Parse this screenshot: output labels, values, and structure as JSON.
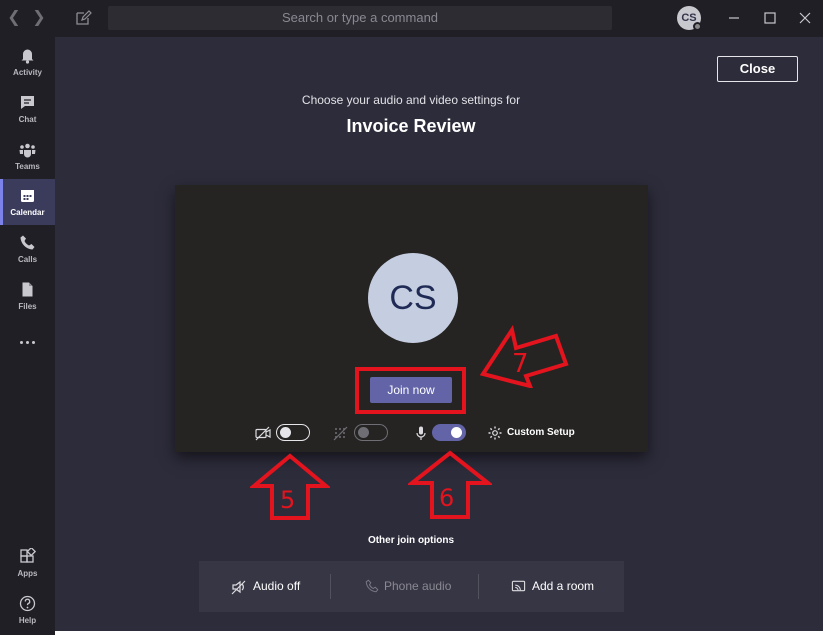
{
  "titlebar": {
    "back_icon": "chevron-left-icon",
    "forward_icon": "chevron-right-icon",
    "search_placeholder": "Search or type a command",
    "avatar_initials": "CS"
  },
  "sidebar": {
    "items": [
      {
        "label": "Activity",
        "icon": "bell-icon"
      },
      {
        "label": "Chat",
        "icon": "chat-icon"
      },
      {
        "label": "Teams",
        "icon": "teams-icon"
      },
      {
        "label": "Calendar",
        "icon": "calendar-icon",
        "active": true
      },
      {
        "label": "Calls",
        "icon": "phone-icon"
      },
      {
        "label": "Files",
        "icon": "file-icon"
      },
      {
        "label": "",
        "icon": "more-icon"
      }
    ],
    "bottom": [
      {
        "label": "Apps",
        "icon": "apps-icon"
      },
      {
        "label": "Help",
        "icon": "help-icon"
      }
    ]
  },
  "main": {
    "close_label": "Close",
    "subtitle": "Choose your audio and video settings for",
    "title": "Invoice Review",
    "avatar_initials": "CS",
    "join_label": "Join now",
    "controls": {
      "camera_on": false,
      "blur_on": false,
      "mic_on": true,
      "custom_setup_label": "Custom Setup"
    },
    "other_join_options_label": "Other join options",
    "options": [
      {
        "label": "Audio off",
        "icon": "speaker-off-icon",
        "enabled": true
      },
      {
        "label": "Phone audio",
        "icon": "phone-icon",
        "enabled": false
      },
      {
        "label": "Add a room",
        "icon": "cast-icon",
        "enabled": true
      }
    ]
  },
  "annotations": [
    {
      "number": "7",
      "direction": "down-left"
    },
    {
      "number": "5",
      "direction": "up"
    },
    {
      "number": "6",
      "direction": "up"
    }
  ],
  "colors": {
    "accent": "#6264a7",
    "annotation_red": "#e3141e",
    "background": "#2d2c3b",
    "rail": "#201f25"
  }
}
